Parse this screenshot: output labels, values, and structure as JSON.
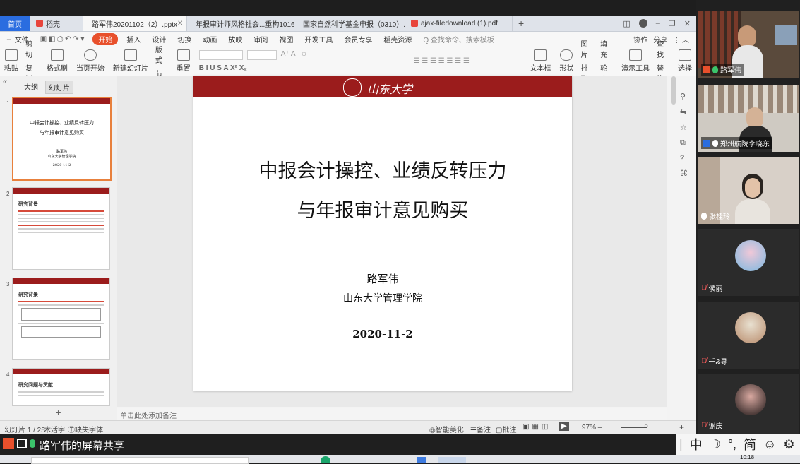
{
  "tabs": [
    {
      "label": "首页"
    },
    {
      "label": "稻壳"
    },
    {
      "label": "路军伟20201102（2）.pptx"
    },
    {
      "label": "年报审计师风格社会...重构1016wsh"
    },
    {
      "label": "国家自然科学基金申报（0310）.pdf"
    },
    {
      "label": "ajax-filedownload (1).pdf"
    }
  ],
  "menu": [
    "三 文件",
    "开始",
    "插入",
    "设计",
    "切换",
    "动画",
    "放映",
    "审阅",
    "视图",
    "开发工具",
    "会员专享",
    "稻壳资源",
    "Q 查找命令、搜索模板"
  ],
  "menu_right": [
    "协作",
    "分享"
  ],
  "ribbon": [
    "粘贴",
    "剪切",
    "复制",
    "格式刷",
    "当页开始",
    "新建幻灯片",
    "版式",
    "节",
    "重置",
    "文本框",
    "形状",
    "图片",
    "填充",
    "排列",
    "轮廓",
    "查找",
    "替换",
    "选择",
    "演示工具"
  ],
  "left_panel": {
    "tab_outline": "大纲",
    "tab_slides": "幻灯片"
  },
  "thumbnails": [
    {
      "num": "1",
      "title_l1": "中报会计操控、业绩反转压力",
      "title_l2": "与年报审计意见购买",
      "sub1": "路军伟",
      "sub2": "山东大学管理学院",
      "sub3": "2020-11-2"
    },
    {
      "num": "2",
      "title": "研究背景"
    },
    {
      "num": "3",
      "title": "研究背景"
    },
    {
      "num": "4",
      "title": "研究问题与贡献"
    }
  ],
  "slide": {
    "brand": "山东大学",
    "title_l1": "中报会计操控、业绩反转压力",
    "title_l2": "与年报审计意见购买",
    "author": "路军伟",
    "school": "山东大学管理学院",
    "date": "2020-11-2"
  },
  "notes_placeholder": "单击此处添加备注",
  "status": {
    "slide_pos": "幻灯片 1 / 25",
    "theme": "木活字",
    "font_missing": "缺失字体",
    "beautify": "智能美化",
    "notes": "备注",
    "comments": "批注",
    "zoom": "97%"
  },
  "share_label": "路军伟的屏幕共享",
  "ime": [
    "中",
    "☽",
    "°,",
    "简",
    "☺",
    "⚙"
  ],
  "participants": [
    {
      "name": "路军伟",
      "mic": "on"
    },
    {
      "name": "郑州航院李晓东",
      "mic": "on"
    },
    {
      "name": "张桂玲",
      "mic": "on"
    },
    {
      "name": "侯丽",
      "mic": "off"
    },
    {
      "name": "千&寻",
      "mic": "off"
    },
    {
      "name": "谢庆",
      "mic": "off"
    }
  ],
  "clock": "10:18",
  "colors": {
    "slide_header": "#9b1c1c",
    "start_tab": "#e8502c",
    "home_tab": "#2a6de0",
    "share_icon": "#e8502c"
  }
}
